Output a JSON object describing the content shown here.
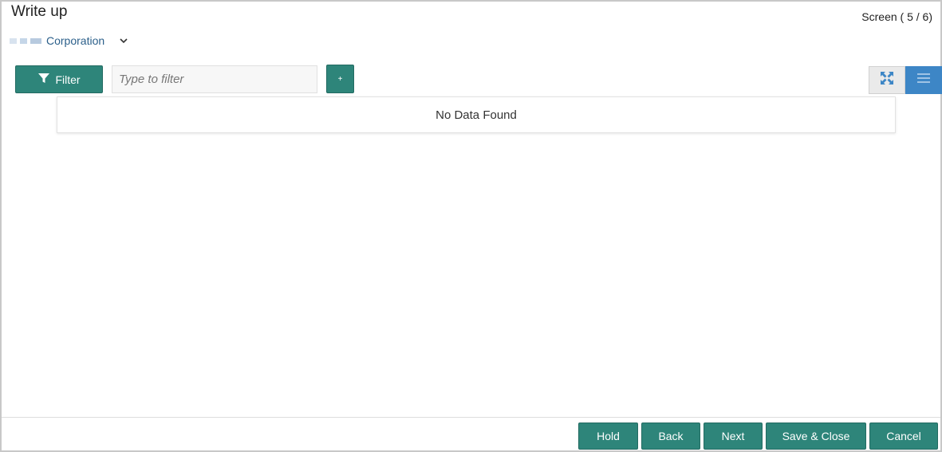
{
  "header": {
    "title": "Write up",
    "screen_indicator": "Screen ( 5 / 6)",
    "customer_type": "Corporation",
    "customer_dropdown_icon": "chevron-down-icon"
  },
  "toolbar": {
    "filter_label": "Filter",
    "filter_icon": "funnel-icon",
    "filter_placeholder": "Type to filter",
    "add_label": "+",
    "tile_view_icon": "expand-icon",
    "list_view_icon": "list-icon"
  },
  "results": {
    "empty_message": "No Data Found"
  },
  "footer": {
    "buttons": [
      {
        "label": "Hold"
      },
      {
        "label": "Back"
      },
      {
        "label": "Next"
      },
      {
        "label": "Save & Close"
      },
      {
        "label": "Cancel"
      }
    ]
  },
  "colors": {
    "primary_button": "#2e857a",
    "active_view_toggle": "#3d86c6",
    "customer_text": "#2b5f8a"
  }
}
